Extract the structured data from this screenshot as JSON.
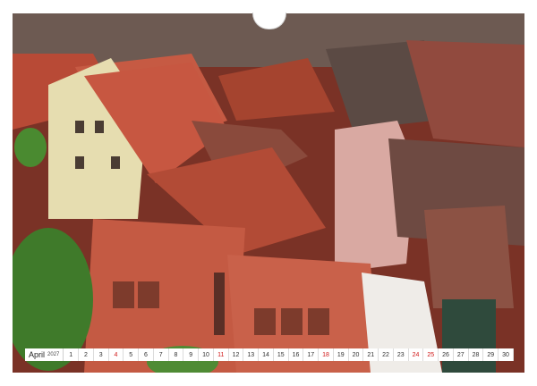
{
  "calendar": {
    "month": "April",
    "year": "2027",
    "days": [
      "1",
      "2",
      "3",
      "4",
      "5",
      "6",
      "7",
      "8",
      "9",
      "10",
      "11",
      "12",
      "13",
      "14",
      "15",
      "16",
      "17",
      "18",
      "19",
      "20",
      "21",
      "22",
      "23",
      "24",
      "25",
      "26",
      "27",
      "28",
      "29",
      "30"
    ],
    "sundays": [
      "4",
      "11",
      "18",
      "25"
    ],
    "holidays": [
      "24"
    ],
    "sunday_color": "#d01818"
  },
  "photo": {
    "subject": "red tiled rooftops of an old town"
  }
}
